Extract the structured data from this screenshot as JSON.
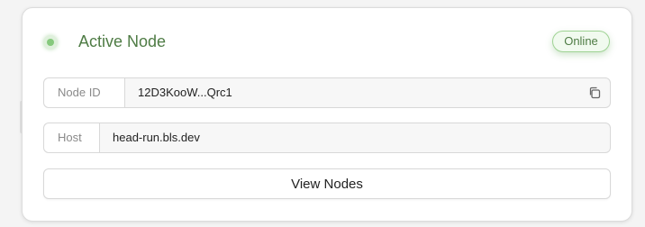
{
  "card": {
    "title": "Active Node",
    "status_badge": "Online",
    "status_indicator_color": "#86c97d",
    "accent_color": "#4f7c45"
  },
  "fields": {
    "node_id": {
      "label": "Node ID",
      "value": "12D3KooW...Qrc1",
      "action_icon": "copy-icon"
    },
    "host": {
      "label": "Host",
      "value": "head-run.bls.dev"
    }
  },
  "actions": {
    "view_nodes_label": "View Nodes"
  }
}
